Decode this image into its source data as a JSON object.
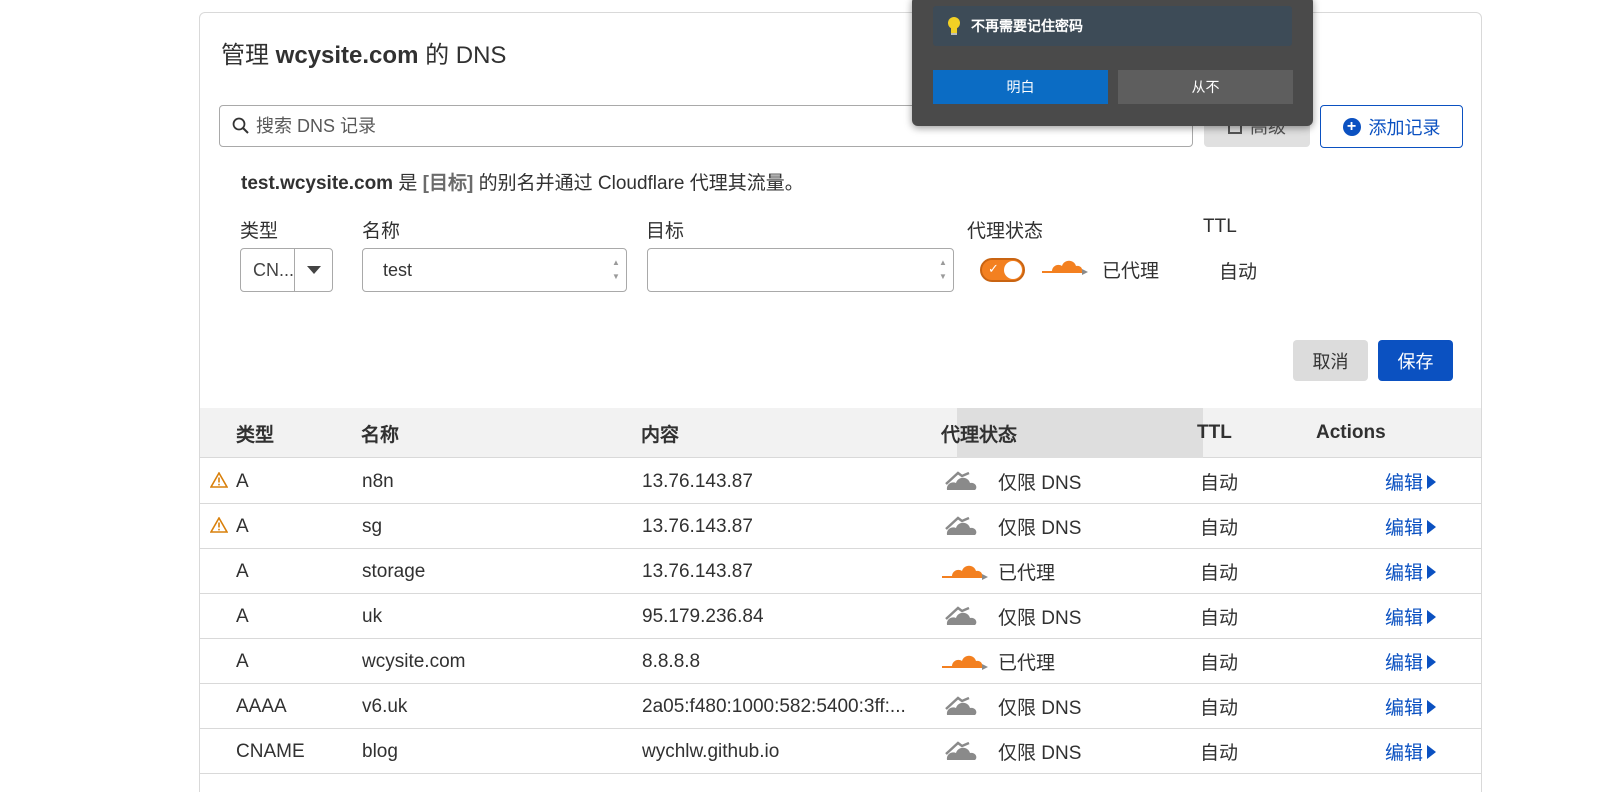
{
  "header": {
    "title_prefix": "管理",
    "domain": "wcysite.com",
    "title_suffix": "的 DNS"
  },
  "search": {
    "placeholder": "搜索 DNS 记录"
  },
  "toolbar": {
    "advanced_label": "高级",
    "add_label": "添加记录"
  },
  "form": {
    "info": {
      "name": "test.wcysite.com",
      "is": "是",
      "target": "[目标]",
      "rest": "的别名并通过 Cloudflare 代理其流量。"
    },
    "labels": {
      "type": "类型",
      "name": "名称",
      "target": "目标",
      "proxy": "代理状态",
      "ttl": "TTL"
    },
    "type_value": "CN...",
    "name_value": "test",
    "target_value": "",
    "proxy_on": true,
    "proxy_text": "已代理",
    "ttl_value": "自动",
    "cancel_label": "取消",
    "save_label": "保存"
  },
  "table": {
    "columns": [
      "类型",
      "名称",
      "内容",
      "代理状态",
      "TTL",
      "Actions"
    ],
    "rows": [
      {
        "warning": true,
        "type": "A",
        "name": "n8n",
        "content": "13.76.143.87",
        "proxied": false,
        "proxy": "仅限 DNS",
        "ttl": "自动",
        "action": "编辑"
      },
      {
        "warning": true,
        "type": "A",
        "name": "sg",
        "content": "13.76.143.87",
        "proxied": false,
        "proxy": "仅限 DNS",
        "ttl": "自动",
        "action": "编辑"
      },
      {
        "warning": false,
        "type": "A",
        "name": "storage",
        "content": "13.76.143.87",
        "proxied": true,
        "proxy": "已代理",
        "ttl": "自动",
        "action": "编辑"
      },
      {
        "warning": false,
        "type": "A",
        "name": "uk",
        "content": "95.179.236.84",
        "proxied": false,
        "proxy": "仅限 DNS",
        "ttl": "自动",
        "action": "编辑"
      },
      {
        "warning": false,
        "type": "A",
        "name": "wcysite.com",
        "content": "8.8.8.8",
        "proxied": true,
        "proxy": "已代理",
        "ttl": "自动",
        "action": "编辑"
      },
      {
        "warning": false,
        "type": "AAAA",
        "name": "v6.uk",
        "content": "2a05:f480:1000:582:5400:3ff:...",
        "proxied": false,
        "proxy": "仅限 DNS",
        "ttl": "自动",
        "action": "编辑"
      },
      {
        "warning": false,
        "type": "CNAME",
        "name": "blog",
        "content": "wychlw.github.io",
        "proxied": false,
        "proxy": "仅限 DNS",
        "ttl": "自动",
        "action": "编辑"
      }
    ]
  },
  "popup": {
    "message": "不再需要记住密码",
    "ok_label": "明白",
    "never_label": "从不"
  },
  "colors": {
    "accent": "#0b51c1",
    "proxy_orange": "#f38020",
    "dns_gray": "#8a8a8a",
    "warning": "#d9800b"
  }
}
